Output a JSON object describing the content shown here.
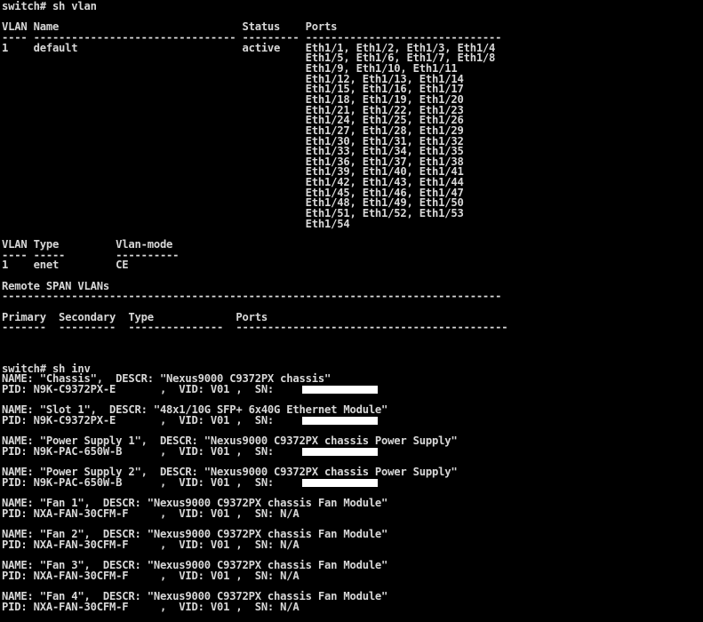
{
  "terminal": {
    "foreground": "#d8d8d8",
    "background": "#000000",
    "redaction_color": "#ffffff",
    "lines": [
      "switch# sh vlan",
      "",
      "VLAN Name                             Status    Ports",
      "---- -------------------------------- --------- -------------------------------",
      "1    default                          active    Eth1/1, Eth1/2, Eth1/3, Eth1/4",
      "                                                Eth1/5, Eth1/6, Eth1/7, Eth1/8",
      "                                                Eth1/9, Eth1/10, Eth1/11",
      "                                                Eth1/12, Eth1/13, Eth1/14",
      "                                                Eth1/15, Eth1/16, Eth1/17",
      "                                                Eth1/18, Eth1/19, Eth1/20",
      "                                                Eth1/21, Eth1/22, Eth1/23",
      "                                                Eth1/24, Eth1/25, Eth1/26",
      "                                                Eth1/27, Eth1/28, Eth1/29",
      "                                                Eth1/30, Eth1/31, Eth1/32",
      "                                                Eth1/33, Eth1/34, Eth1/35",
      "                                                Eth1/36, Eth1/37, Eth1/38",
      "                                                Eth1/39, Eth1/40, Eth1/41",
      "                                                Eth1/42, Eth1/43, Eth1/44",
      "                                                Eth1/45, Eth1/46, Eth1/47",
      "                                                Eth1/48, Eth1/49, Eth1/50",
      "                                                Eth1/51, Eth1/52, Eth1/53",
      "                                                Eth1/54",
      "",
      "VLAN Type         Vlan-mode",
      "---- -----        ----------",
      "1    enet         CE",
      "",
      "Remote SPAN VLANs",
      "-------------------------------------------------------------------------------",
      "",
      "Primary  Secondary  Type             Ports",
      "-------  ---------  ---------------  -------------------------------------------",
      "",
      "",
      "",
      "switch# sh inv",
      "NAME: \"Chassis\",  DESCR: \"Nexus9000 C9372PX chassis\"",
      "PID: N9K-C9372PX-E       ,  VID: V01 ,  SN:",
      "",
      "NAME: \"Slot 1\",  DESCR: \"48x1/10G SFP+ 6x40G Ethernet Module\"",
      "PID: N9K-C9372PX-E       ,  VID: V01 ,  SN:",
      "",
      "NAME: \"Power Supply 1\",  DESCR: \"Nexus9000 C9372PX chassis Power Supply\"",
      "PID: N9K-PAC-650W-B      ,  VID: V01 ,  SN:",
      "",
      "NAME: \"Power Supply 2\",  DESCR: \"Nexus9000 C9372PX chassis Power Supply\"",
      "PID: N9K-PAC-650W-B      ,  VID: V01 ,  SN:",
      "",
      "NAME: \"Fan 1\",  DESCR: \"Nexus9000 C9372PX chassis Fan Module\"",
      "PID: NXA-FAN-30CFM-F     ,  VID: V01 ,  SN: N/A",
      "",
      "NAME: \"Fan 2\",  DESCR: \"Nexus9000 C9372PX chassis Fan Module\"",
      "PID: NXA-FAN-30CFM-F     ,  VID: V01 ,  SN: N/A",
      "",
      "NAME: \"Fan 3\",  DESCR: \"Nexus9000 C9372PX chassis Fan Module\"",
      "PID: NXA-FAN-30CFM-F     ,  VID: V01 ,  SN: N/A",
      "",
      "NAME: \"Fan 4\",  DESCR: \"Nexus9000 C9372PX chassis Fan Module\"",
      "PID: NXA-FAN-30CFM-F     ,  VID: V01 ,  SN: N/A"
    ]
  }
}
